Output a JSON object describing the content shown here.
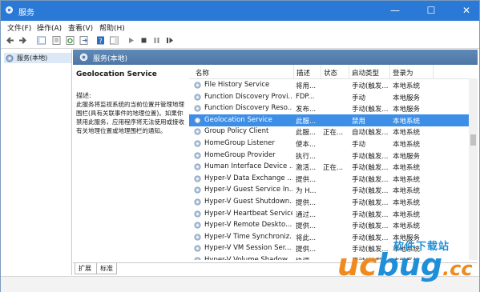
{
  "window": {
    "title": "服务",
    "controls": [
      "—",
      "☐",
      "✕"
    ]
  },
  "menu": [
    "文件(F)",
    "操作(A)",
    "查看(V)",
    "帮助(H)"
  ],
  "toolbar_icons": [
    "back-arrow-icon",
    "forward-arrow-icon",
    "console-tree-icon",
    "properties-icon",
    "refresh-icon",
    "export-icon",
    "help-icon",
    "pane-icon",
    "play-icon",
    "stop-icon",
    "pause-icon",
    "restart-icon"
  ],
  "tree": {
    "item": "服务(本地)"
  },
  "header": {
    "label": "服务(本地)"
  },
  "details": {
    "service_name": "Geolocation Service",
    "desc_label": "描述:",
    "desc_text": "此服务将监视系统的当前位置并管理地理围栏(具有关联事件的地理位置)。如果你禁用此服务，应用程序将无法使用或接收有关地理位置或地理围栏的通知。"
  },
  "columns": [
    "名称",
    "描述",
    "状态",
    "启动类型",
    "登录为"
  ],
  "rows": [
    {
      "name": "File History Service",
      "desc": "将用...",
      "status": "",
      "start": "手动(触发...",
      "logon": "本地系统"
    },
    {
      "name": "Function Discovery Provi...",
      "desc": "FDP...",
      "status": "",
      "start": "手动",
      "logon": "本地服务"
    },
    {
      "name": "Function Discovery Reso...",
      "desc": "发布...",
      "status": "",
      "start": "手动(触发...",
      "logon": "本地服务"
    },
    {
      "name": "Geolocation Service",
      "desc": "此服...",
      "status": "",
      "start": "禁用",
      "logon": "本地系统"
    },
    {
      "name": "Group Policy Client",
      "desc": "此服...",
      "status": "正在...",
      "start": "自动(触发...",
      "logon": "本地系统"
    },
    {
      "name": "HomeGroup Listener",
      "desc": "使本...",
      "status": "",
      "start": "手动",
      "logon": "本地系统"
    },
    {
      "name": "HomeGroup Provider",
      "desc": "执行...",
      "status": "",
      "start": "手动(触发...",
      "logon": "本地服务"
    },
    {
      "name": "Human Interface Device ...",
      "desc": "激活...",
      "status": "正在...",
      "start": "手动(触发...",
      "logon": "本地系统"
    },
    {
      "name": "Hyper-V Data Exchange ...",
      "desc": "提供...",
      "status": "",
      "start": "手动(触发...",
      "logon": "本地系统"
    },
    {
      "name": "Hyper-V Guest Service In...",
      "desc": "为 H...",
      "status": "",
      "start": "手动(触发...",
      "logon": "本地系统"
    },
    {
      "name": "Hyper-V Guest Shutdown...",
      "desc": "提供...",
      "status": "",
      "start": "手动(触发...",
      "logon": "本地系统"
    },
    {
      "name": "Hyper-V Heartbeat Service",
      "desc": "通过...",
      "status": "",
      "start": "手动(触发...",
      "logon": "本地系统"
    },
    {
      "name": "Hyper-V Remote Deskto...",
      "desc": "提供...",
      "status": "",
      "start": "手动(触发...",
      "logon": "本地系统"
    },
    {
      "name": "Hyper-V Time Synchroniz...",
      "desc": "将此...",
      "status": "",
      "start": "手动(触发...",
      "logon": "本地服务"
    },
    {
      "name": "Hyper-V VM Session Ser...",
      "desc": "提供...",
      "status": "",
      "start": "手动(触发...",
      "logon": "本地系统"
    },
    {
      "name": "Hyper-V Volume Shadow...",
      "desc": "协调...",
      "status": "",
      "start": "手动(触发...",
      "logon": "本地系统"
    }
  ],
  "selected_row": 3,
  "tabs": [
    "扩展",
    "标准"
  ],
  "watermark": {
    "top": "软件下载站",
    "main": "ucbug.cc"
  },
  "colors": {
    "titlebar": "#2b79d6",
    "header": "#4e77a5",
    "selection": "#3d8ee6",
    "wm_orange": "#f08a1c",
    "wm_blue": "#1e8fd8"
  }
}
